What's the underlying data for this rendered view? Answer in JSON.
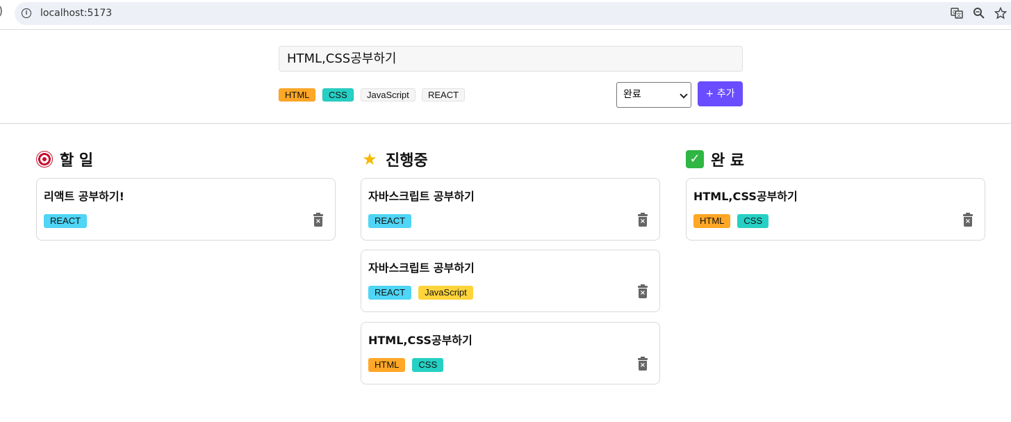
{
  "browser": {
    "url": "localhost:5173",
    "icons": [
      "info-icon",
      "translate-icon",
      "zoom-icon",
      "star-icon"
    ]
  },
  "form": {
    "input_value": "HTML,CSS공부하기",
    "tags": [
      {
        "label": "HTML",
        "selected": true,
        "color": "#ffa726"
      },
      {
        "label": "CSS",
        "selected": true,
        "color": "#26d0c4"
      },
      {
        "label": "JavaScript",
        "selected": false,
        "color": "#f5f5f5"
      },
      {
        "label": "REACT",
        "selected": false,
        "color": "#f5f5f5"
      }
    ],
    "status_selected": "완료",
    "add_label": "+ 추가"
  },
  "columns": [
    {
      "title": "할 일",
      "emoji": "target-icon",
      "cards": [
        {
          "title": "리액트 공부하기!",
          "tags": [
            "REACT"
          ]
        }
      ]
    },
    {
      "title": "진행중",
      "emoji": "glowing-star-icon",
      "cards": [
        {
          "title": "자바스크립트 공부하기",
          "tags": [
            "REACT"
          ]
        },
        {
          "title": "자바스크립트 공부하기",
          "tags": [
            "REACT",
            "JavaScript"
          ]
        },
        {
          "title": "HTML,CSS공부하기",
          "tags": [
            "HTML",
            "CSS"
          ]
        }
      ]
    },
    {
      "title": "완 료",
      "emoji": "check-mark-icon",
      "cards": [
        {
          "title": "HTML,CSS공부하기",
          "tags": [
            "HTML",
            "CSS"
          ]
        }
      ]
    }
  ],
  "tag_colors": {
    "HTML": "#ffa726",
    "CSS": "#26d0c4",
    "JavaScript": "#ffd43b",
    "REACT": "#4fd5f5"
  }
}
